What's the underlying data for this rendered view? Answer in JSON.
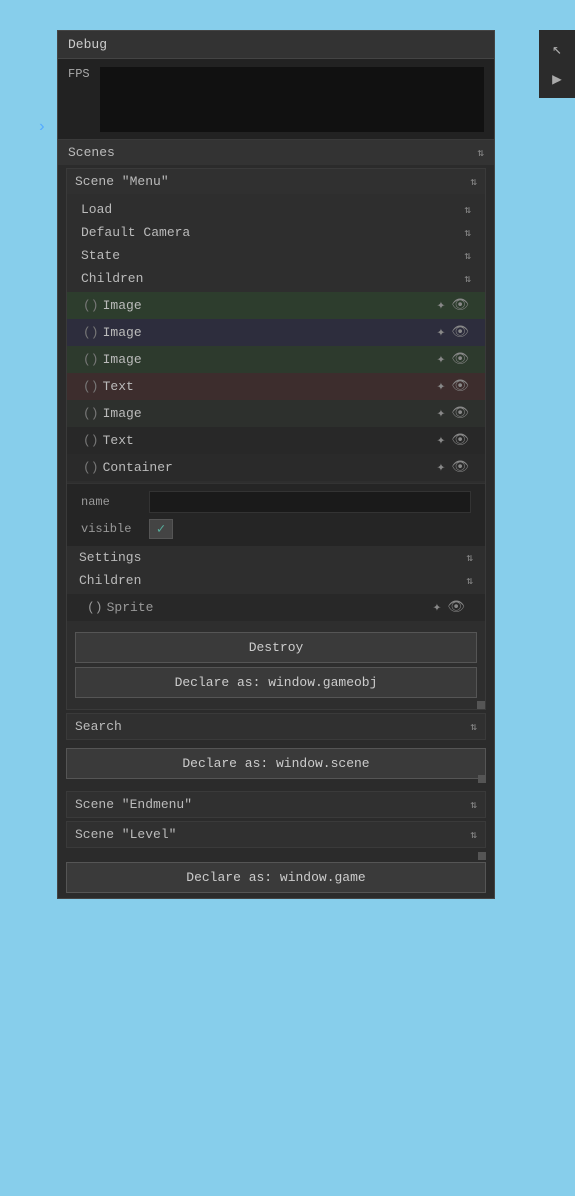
{
  "panel": {
    "title": "Debug",
    "fps_label": "FPS"
  },
  "scenes_section": {
    "label": "Scenes"
  },
  "scene_menu": {
    "title": "Scene \"Menu\"",
    "load": {
      "label": "Load"
    },
    "default_camera": {
      "label": "Default Camera"
    },
    "state": {
      "label": "State"
    },
    "children": {
      "label": "Children",
      "items": [
        {
          "type": "Image",
          "paren": "()"
        },
        {
          "type": "Image",
          "paren": "()"
        },
        {
          "type": "Image",
          "paren": "()"
        },
        {
          "type": "Text",
          "paren": "()"
        },
        {
          "type": "Image",
          "paren": "()"
        },
        {
          "type": "Text",
          "paren": "()"
        },
        {
          "type": "Container",
          "paren": "()"
        }
      ]
    },
    "props": {
      "name_label": "name",
      "visible_label": "visible"
    },
    "settings": {
      "label": "Settings"
    },
    "inner_children": {
      "label": "Children",
      "items": [
        {
          "type": "Sprite",
          "paren": "()"
        }
      ]
    },
    "destroy_btn": "Destroy",
    "declare_gameobj_btn": "Declare as: window.gameobj"
  },
  "search_section": {
    "label": "Search"
  },
  "declare_scene_btn": "Declare as: window.scene",
  "scene_endmenu": {
    "title": "Scene \"Endmenu\""
  },
  "scene_level": {
    "title": "Scene \"Level\""
  },
  "declare_game_btn": "Declare as: window.game",
  "icons": {
    "arrows": "⇅",
    "move": "✦",
    "eye": "👁",
    "check": "✓",
    "chevron_right": "›",
    "cursor": "↖",
    "play": "▶",
    "settings": "⚙",
    "expand": "›"
  }
}
